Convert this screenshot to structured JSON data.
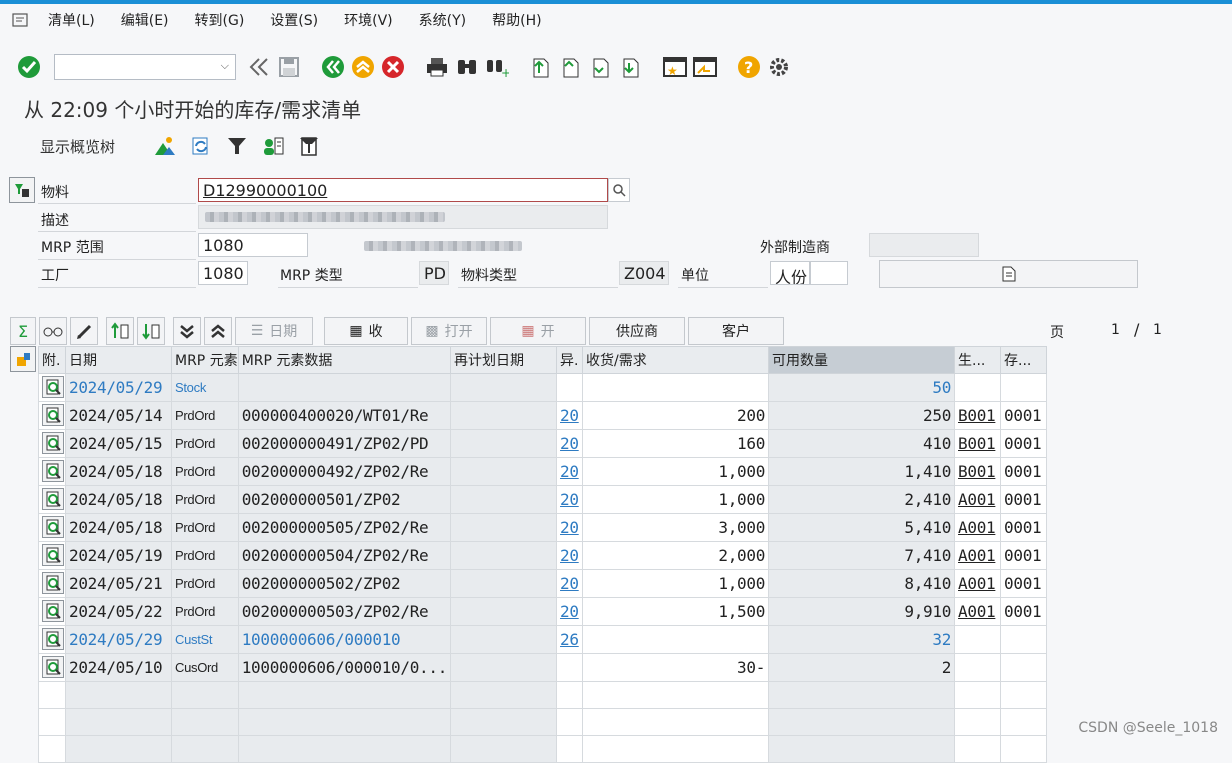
{
  "menubar": {
    "items": [
      "清单(L)",
      "编辑(E)",
      "转到(G)",
      "设置(S)",
      "环境(V)",
      "系统(Y)",
      "帮助(H)"
    ]
  },
  "title": "从 22:09 个小时开始的库存/需求清单",
  "apptoolbar": {
    "label": "显示概览树"
  },
  "header": {
    "material_label": "物料",
    "material_value": "D12990000100",
    "desc_label": "描述",
    "mrp_area_label": "MRP 范围",
    "mrp_area_value": "1080",
    "external_label": "外部制造商",
    "plant_label": "工厂",
    "plant_value": "1080",
    "mrp_type_label": "MRP 类型",
    "mrp_type_value": "PD",
    "mat_type_label": "物料类型",
    "mat_type_value": "Z004",
    "unit_label": "单位",
    "unit_value": "人份"
  },
  "alv_toolbar": {
    "date": "日期",
    "receive": "收",
    "open": "打开",
    "open2": "开",
    "vendor": "供应商",
    "customer": "客户",
    "page_label": "页",
    "page_current": "1",
    "page_sep": "/",
    "page_total": "1"
  },
  "grid": {
    "columns": [
      "附.",
      "日期",
      "MRP 元素",
      "MRP 元素数据",
      "再计划日期",
      "异.",
      "收货/需求",
      "可用数量",
      "生...",
      "存..."
    ],
    "rows": [
      {
        "date": "2024/05/29",
        "elem": "Stock",
        "data": "",
        "reschedule": "",
        "exc": "",
        "recreq": "",
        "avail": "50",
        "prod": "",
        "stor": "",
        "kind": "stock"
      },
      {
        "date": "2024/05/14",
        "elem": "PrdOrd",
        "data": "000000400020/WT01/Re",
        "reschedule": "",
        "exc": "20",
        "recreq": "200",
        "avail": "250",
        "prod": "B001",
        "stor": "0001",
        "kind": "normal"
      },
      {
        "date": "2024/05/15",
        "elem": "PrdOrd",
        "data": "002000000491/ZP02/PD",
        "reschedule": "",
        "exc": "20",
        "recreq": "160",
        "avail": "410",
        "prod": "B001",
        "stor": "0001",
        "kind": "normal"
      },
      {
        "date": "2024/05/18",
        "elem": "PrdOrd",
        "data": "002000000492/ZP02/Re",
        "reschedule": "",
        "exc": "20",
        "recreq": "1,000",
        "avail": "1,410",
        "prod": "B001",
        "stor": "0001",
        "kind": "normal"
      },
      {
        "date": "2024/05/18",
        "elem": "PrdOrd",
        "data": "002000000501/ZP02",
        "reschedule": "",
        "exc": "20",
        "recreq": "1,000",
        "avail": "2,410",
        "prod": "A001",
        "stor": "0001",
        "kind": "normal"
      },
      {
        "date": "2024/05/18",
        "elem": "PrdOrd",
        "data": "002000000505/ZP02/Re",
        "reschedule": "",
        "exc": "20",
        "recreq": "3,000",
        "avail": "5,410",
        "prod": "A001",
        "stor": "0001",
        "kind": "normal"
      },
      {
        "date": "2024/05/19",
        "elem": "PrdOrd",
        "data": "002000000504/ZP02/Re",
        "reschedule": "",
        "exc": "20",
        "recreq": "2,000",
        "avail": "7,410",
        "prod": "A001",
        "stor": "0001",
        "kind": "normal"
      },
      {
        "date": "2024/05/21",
        "elem": "PrdOrd",
        "data": "002000000502/ZP02",
        "reschedule": "",
        "exc": "20",
        "recreq": "1,000",
        "avail": "8,410",
        "prod": "A001",
        "stor": "0001",
        "kind": "normal"
      },
      {
        "date": "2024/05/22",
        "elem": "PrdOrd",
        "data": "002000000503/ZP02/Re",
        "reschedule": "",
        "exc": "20",
        "recreq": "1,500",
        "avail": "9,910",
        "prod": "A001",
        "stor": "0001",
        "kind": "normal"
      },
      {
        "date": "2024/05/29",
        "elem": "CustSt",
        "data": "1000000606/000010",
        "reschedule": "",
        "exc": "26",
        "recreq": "",
        "avail": "32",
        "prod": "",
        "stor": "",
        "kind": "cust"
      },
      {
        "date": "2024/05/10",
        "elem": "CusOrd",
        "data": "1000000606/000010/0...",
        "reschedule": "",
        "exc": "",
        "recreq": "30-",
        "avail": "2",
        "prod": "",
        "stor": "",
        "kind": "normal"
      }
    ]
  },
  "watermark": "CSDN @Seele_1018",
  "colors": {
    "accent": "#1a8fd6",
    "green": "#1f9b3a",
    "orange": "#f0a500",
    "red": "#d6262b",
    "link": "#2e7bc2"
  }
}
